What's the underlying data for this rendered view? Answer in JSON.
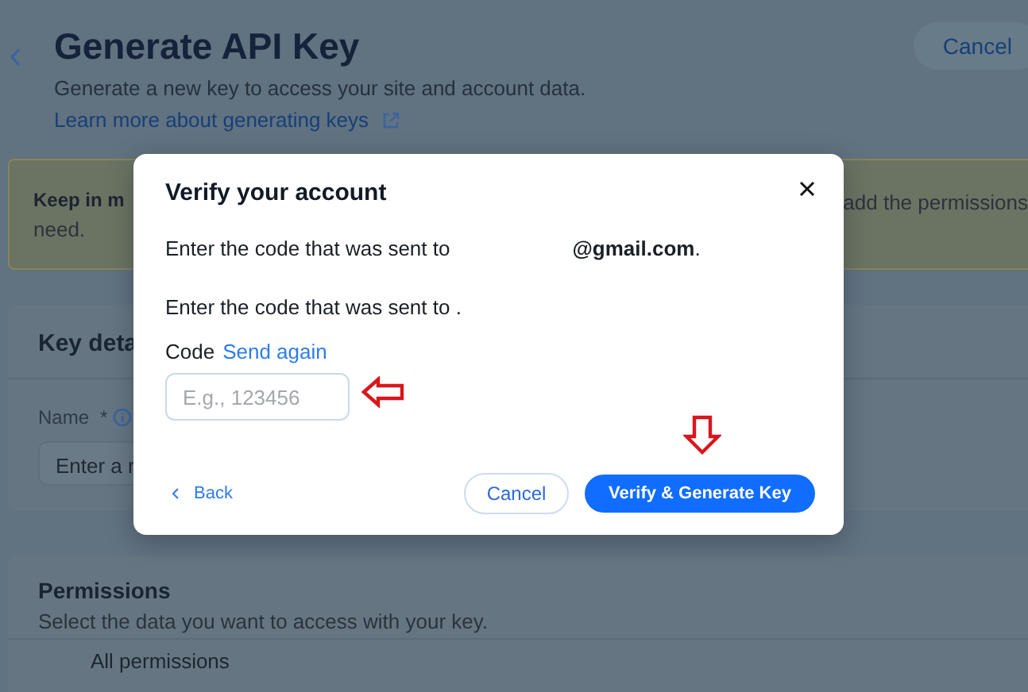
{
  "page": {
    "title": "Generate API Key",
    "subtitle": "Generate a new key to access your site and account data.",
    "learn_link": "Learn more about generating keys",
    "cancel": "Cancel"
  },
  "notice": {
    "left_text": "Keep in m",
    "left_text_2": "need.",
    "right_text": "add the permissions"
  },
  "key_details": {
    "title": "Key deta",
    "name_label": "Name",
    "required_mark": "*",
    "name_placeholder": "Enter a r"
  },
  "permissions": {
    "title": "Permissions",
    "subtitle": "Select the data you want to access with your key.",
    "item": "All permissions"
  },
  "dialog": {
    "title": "Verify your account",
    "line_1": "Enter the code that was sent to",
    "email": "**@gmail.com**.",
    "line_2": "Enter the code that was sent to .",
    "code_label": "Code",
    "send_again": "Send again",
    "code_placeholder": "E.g., 123456",
    "back": "Back",
    "cancel": "Cancel",
    "confirm": "Verify & Generate Key"
  }
}
